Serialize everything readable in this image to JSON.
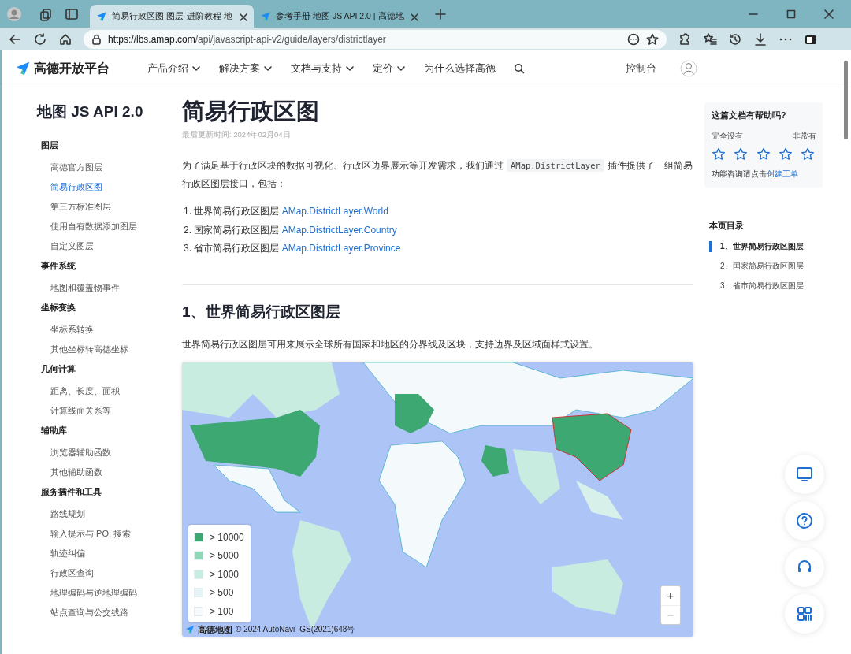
{
  "browser": {
    "tabs": [
      {
        "title": "简易行政区图-图层-进阶教程-地",
        "selected": true
      },
      {
        "title": "参考手册-地图 JS API 2.0 | 高德地",
        "selected": false
      }
    ],
    "url_host": "https://lbs.amap.com",
    "url_path": "/api/javascript-api-v2/guide/layers/districtlayer"
  },
  "header": {
    "logo": "高德开放平台",
    "nav": [
      {
        "label": "产品介绍",
        "dropdown": true
      },
      {
        "label": "解决方案",
        "dropdown": true
      },
      {
        "label": "文档与支持",
        "dropdown": true
      },
      {
        "label": "定价",
        "dropdown": true
      },
      {
        "label": "为什么选择高德",
        "dropdown": false
      }
    ],
    "console": "控制台"
  },
  "sidebar": {
    "title": "地图 JS API 2.0",
    "groups": [
      {
        "title": "图层",
        "items": [
          {
            "label": "高德官方图层",
            "selected": false
          },
          {
            "label": "简易行政区图",
            "selected": true
          },
          {
            "label": "第三方标准图层",
            "selected": false
          },
          {
            "label": "使用自有数据添加图层",
            "selected": false
          },
          {
            "label": "自定义图层",
            "selected": false
          }
        ]
      },
      {
        "title": "事件系统",
        "items": [
          {
            "label": "地图和覆盖物事件",
            "selected": false
          }
        ]
      },
      {
        "title": "坐标变换",
        "items": [
          {
            "label": "坐标系转换",
            "selected": false
          },
          {
            "label": "其他坐标转高德坐标",
            "selected": false
          }
        ]
      },
      {
        "title": "几何计算",
        "items": [
          {
            "label": "距离、长度、面积",
            "selected": false
          },
          {
            "label": "计算线面关系等",
            "selected": false
          }
        ]
      },
      {
        "title": "辅助库",
        "items": [
          {
            "label": "浏览器辅助函数",
            "selected": false
          },
          {
            "label": "其他辅助函数",
            "selected": false
          }
        ]
      },
      {
        "title": "服务插件和工具",
        "items": [
          {
            "label": "路线规划",
            "selected": false
          },
          {
            "label": "输入提示与 POI 搜索",
            "selected": false
          },
          {
            "label": "轨迹纠偏",
            "selected": false
          },
          {
            "label": "行政区查询",
            "selected": false
          },
          {
            "label": "地理编码与逆地理编码",
            "selected": false
          },
          {
            "label": "站点查询与公交线路",
            "selected": false
          }
        ]
      }
    ]
  },
  "article": {
    "title": "简易行政区图",
    "updated": "最后更新时间: 2024年02月04日",
    "intro": {
      "before": "为了满足基于行政区块的数据可视化、行政区边界展示等开发需求，我们通过",
      "code": "AMap.DistrictLayer",
      "after": "插件提供了一组简易行政区图层接口，包括："
    },
    "list": [
      {
        "number": "1.",
        "text": "世界简易行政区图层",
        "link": "AMap.DistrictLayer.World"
      },
      {
        "number": "2.",
        "text": "国家简易行政区图层",
        "link": "AMap.DistrictLayer.Country"
      },
      {
        "number": "3.",
        "text": "省市简易行政区图层",
        "link": "AMap.DistrictLayer.Province"
      }
    ],
    "section_title": "1、世界简易行政区图层",
    "section_text": "世界简易行政区图层可用来展示全球所有国家和地区的分界线及区块，支持边界及区域面样式设置。",
    "map": {
      "kind": "picture",
      "legend": [
        {
          "label": "> 10000",
          "color": "#3da872"
        },
        {
          "label": "> 5000",
          "color": "#8fd6b6"
        },
        {
          "label": "> 1000",
          "color": "#c9ece0"
        },
        {
          "label": "> 500",
          "color": "#e6f4f6"
        },
        {
          "label": "> 100",
          "color": "#f7fbfd"
        }
      ],
      "zoom_in": "+",
      "zoom_out": "−",
      "attribution_logo": "高德地图",
      "attribution": "© 2024 AutoNavi -GS(2021)648号"
    }
  },
  "feedback": {
    "title": "这篇文档有帮助吗?",
    "low": "完全没有",
    "high": "非常有",
    "stars": 0,
    "footer": "功能咨询请点击",
    "footer_link": "创建工单"
  },
  "toc": {
    "title": "本页目录",
    "items": [
      {
        "label": "1、世界简易行政区图层",
        "selected": true
      },
      {
        "label": "2、国家简易行政区图层",
        "selected": false
      },
      {
        "label": "3、省市简易行政区图层",
        "selected": false
      }
    ]
  }
}
